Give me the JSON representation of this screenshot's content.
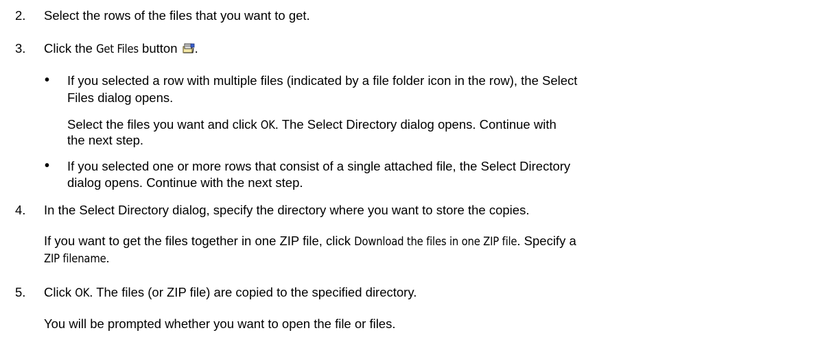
{
  "steps": {
    "s2": {
      "num": "2.",
      "text": "Select the rows of the files that you want to get."
    },
    "s3": {
      "num": "3.",
      "pre": "Click the ",
      "ui": "Get Files",
      "post": " button",
      "end": ".",
      "icon": "get-files-icon",
      "b1_l1": "If you selected a row with multiple files (indicated by a file folder icon in the row), the Select",
      "b1_l2": "Files dialog opens.",
      "p1_pre": "Select the files you want and click ",
      "p1_ui": "OK",
      "p1_post": ". The Select Directory dialog opens. Continue with",
      "p1_l2": "the next step.",
      "b2_l1": "If you selected one or more rows that consist of a single attached file, the Select Directory",
      "b2_l2": "dialog opens. Continue with the next step."
    },
    "s4": {
      "num": "4.",
      "text": "In the Select Directory dialog, specify the directory where you want to store the copies.",
      "p_pre": "If you want to get the files together in one ZIP file, click ",
      "p_ui": "Download the files in one ZIP file",
      "p_post": ". Specify a",
      "p_ui2": "ZIP filename",
      "p_end": "."
    },
    "s5": {
      "num": "5.",
      "pre": "Click ",
      "ui": "OK",
      "post": ". The files (or ZIP file) are copied to the specified directory.",
      "p": "You will be prompted whether you want to open the file or files."
    }
  },
  "bullet_char": "•"
}
